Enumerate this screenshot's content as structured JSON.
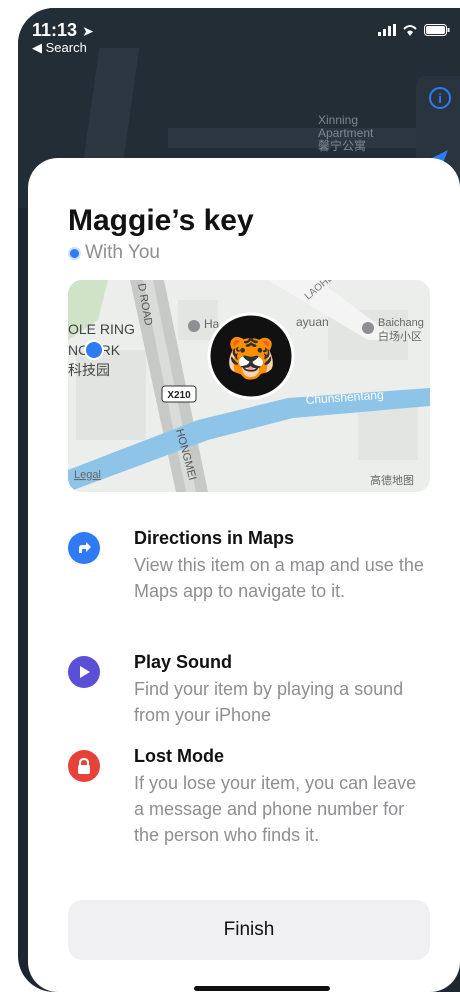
{
  "status_bar": {
    "time": "11:13",
    "back_label": "Search"
  },
  "background_map": {
    "label_lines": [
      "Xinning",
      "Apartment",
      "馨宁公寓"
    ]
  },
  "sheet": {
    "title": "Maggie’s key",
    "subtitle": "With You",
    "map": {
      "labels": {
        "road": "D ROAD",
        "ole_ring": "OLE RING",
        "park": "NC ARK",
        "chinese_park": "科技园",
        "ha": "Ha",
        "ayuan": "ayuan",
        "laohe": "LAOHE",
        "baichang": "Baichang",
        "baichang_cn": "白场小区",
        "x210": "X210",
        "chunshentang": "Chunshentang",
        "hongmei": "HONGMEI",
        "legal": "Legal",
        "provider": "高德地图"
      },
      "avatar_emoji": "🐯"
    },
    "features": [
      {
        "title": "Directions in Maps",
        "description": "View this item on a map and use the Maps app to navigate to it.",
        "icon": "directions-icon",
        "color": "#2f7bf5"
      },
      {
        "title": "Play Sound",
        "description": "Find your item by playing a sound from your iPhone",
        "icon": "play-icon",
        "color": "#5b4fd6"
      },
      {
        "title": "Lost Mode",
        "description": "If you lose your item, you can leave a message and phone number for the person who finds it.",
        "icon": "lock-icon",
        "color": "#e5433a"
      }
    ],
    "finish_label": "Finish"
  }
}
